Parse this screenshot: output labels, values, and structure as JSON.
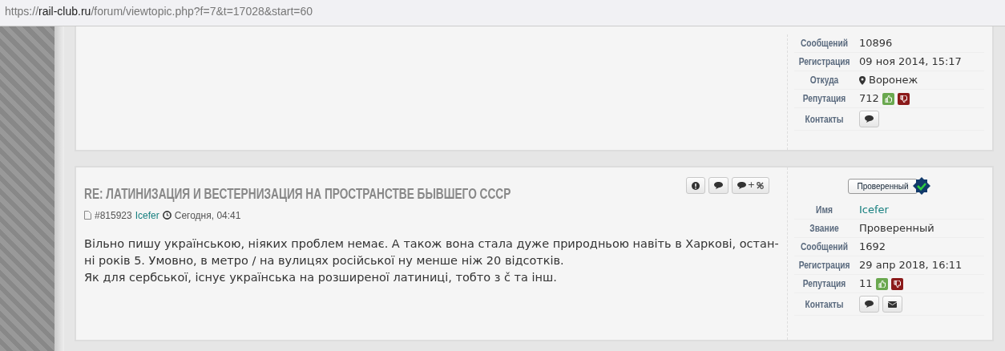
{
  "address_bar": {
    "scheme": "https://",
    "domain": "rail-club.ru",
    "path": "/forum/viewtopic.php?f=7&t=17028&start=60"
  },
  "posts": [
    {
      "profile": [
        {
          "kind": "text",
          "label": "Сообщений",
          "value": "10896"
        },
        {
          "kind": "text",
          "label": "Регистрация",
          "value": "09 ноя 2014, 15:17"
        },
        {
          "kind": "location",
          "label": "Откуда",
          "value": "Воронеж"
        },
        {
          "kind": "reputation",
          "label": "Репутация",
          "value": "712"
        },
        {
          "kind": "contacts",
          "label": "Контакты",
          "contacts": [
            {
              "kind": "pm"
            }
          ]
        }
      ]
    },
    {
      "title": "RE: ЛАТИНИЗАЦИЯ И ВЕСТЕРНИЗАЦИЯ НА ПРОСТРАНСТВЕ БЫВШЕГО СССР",
      "post_id": "#815923",
      "author": "Icefer",
      "time": "Сегодня, 04:41",
      "actions": [
        {
          "kind": "report"
        },
        {
          "kind": "quote"
        },
        {
          "kind": "multiquote",
          "text": "+"
        }
      ],
      "body_lines": [
        "Вільно пишу українською, ніяких проблем немає. А також вона стала дуже природньою навіть в Харкові, остан-",
        "ні років 5. Умовно, в метро / на вулицях російської ну менше ніж 20 відсотків.",
        "Як для сербської, існує українська на розширеної латиниці, тобто з č та інш."
      ],
      "rank_badge": "Проверенный",
      "profile": [
        {
          "kind": "link",
          "label": "Имя",
          "value": "Icefer"
        },
        {
          "kind": "text",
          "label": "Звание",
          "value": "Проверенный"
        },
        {
          "kind": "text",
          "label": "Сообщений",
          "value": "1692"
        },
        {
          "kind": "text",
          "label": "Регистрация",
          "value": "29 апр 2018, 16:11"
        },
        {
          "kind": "reputation",
          "label": "Репутация",
          "value": "11"
        },
        {
          "kind": "contacts",
          "label": "Контакты",
          "contacts": [
            {
              "kind": "pm"
            },
            {
              "kind": "email"
            }
          ]
        }
      ]
    }
  ]
}
